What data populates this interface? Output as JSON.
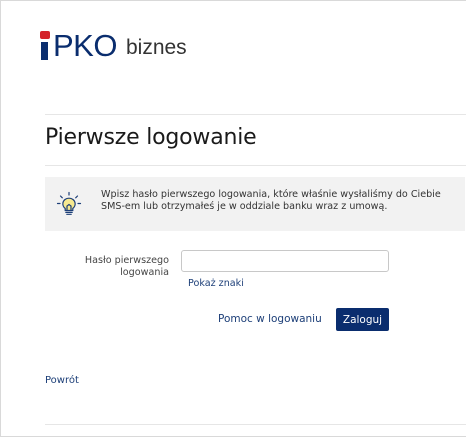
{
  "header": {
    "logo_pko": "PKO",
    "logo_biznes": "biznes",
    "brand_colors": {
      "navy": "#0a2d6e",
      "red": "#d4232b"
    }
  },
  "page": {
    "title": "Pierwsze logowanie"
  },
  "info": {
    "icon": "lightbulb-icon",
    "text": "Wpisz hasło pierwszego logowania, które właśnie wysłaliśmy do Ciebie SMS-em lub otrzymałeś je w oddziale banku wraz z umową."
  },
  "form": {
    "password_label_line1": "Hasło pierwszego",
    "password_label_line2": "logowania",
    "password_value": "",
    "show_chars_label": "Pokaż znaki",
    "help_label": "Pomoc w logowaniu",
    "login_label": "Zaloguj"
  },
  "footer": {
    "back_label": "Powrót"
  }
}
